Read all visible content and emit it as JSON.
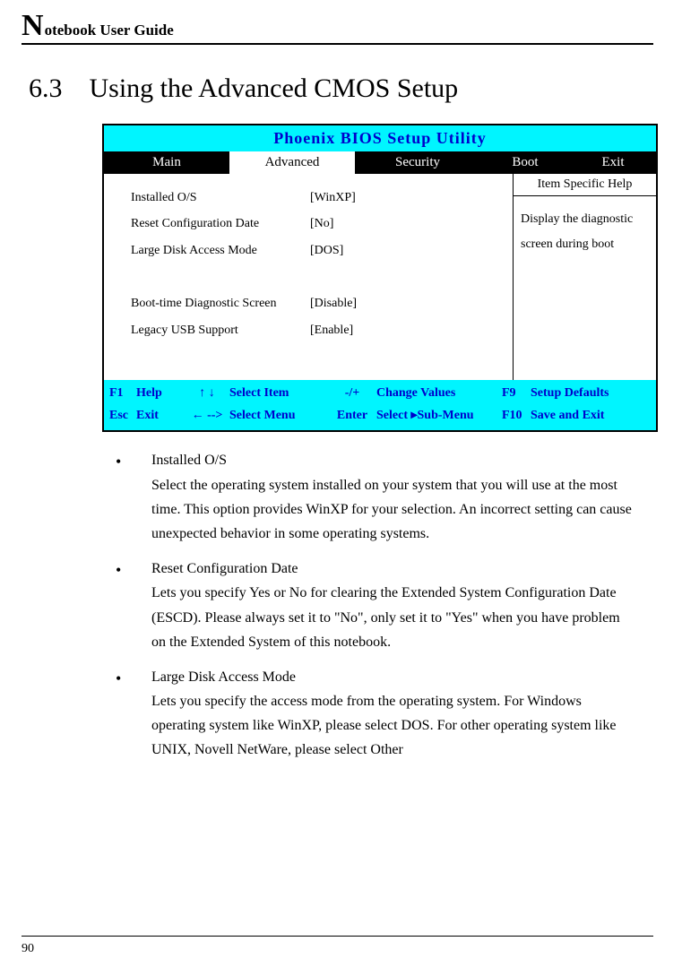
{
  "header": {
    "big_letter": "N",
    "rest": "otebook User Guide"
  },
  "section": {
    "number": "6.3",
    "title": "Using the Advanced CMOS Setup"
  },
  "bios": {
    "title": "Phoenix BIOS Setup Utility",
    "tabs": {
      "main": "Main",
      "advanced": "Advanced",
      "security": "Security",
      "boot": "Boot",
      "exit": "Exit"
    },
    "rows": [
      {
        "label": "Installed O/S",
        "value": "[WinXP]"
      },
      {
        "label": "Reset Configuration Date",
        "value": "[No]"
      },
      {
        "label": "Large Disk Access Mode",
        "value": "[DOS]"
      }
    ],
    "rows2": [
      {
        "label": "Boot-time Diagnostic Screen",
        "value": "[Disable]"
      },
      {
        "label": "Legacy USB Support",
        "value": "[Enable]"
      }
    ],
    "help_header": "Item Specific Help",
    "help_line1": "Display the diagnostic",
    "help_line2": "screen during boot",
    "footer": {
      "r1": {
        "k1": "F1",
        "k2": "Help",
        "k3": "↑  ↓",
        "k4": "Select Item",
        "k5": "-/+",
        "k6": "Change Values",
        "k7": "F9",
        "k8": "Setup Defaults"
      },
      "r2": {
        "k1": "Esc",
        "k2": "Exit",
        "k3": "← -->",
        "k4": "Select Menu",
        "k5": "Enter",
        "k6": "Select  ▸Sub-Menu",
        "k7": "F10",
        "k8": "Save and Exit"
      }
    }
  },
  "bullets": {
    "b1_title": "Installed O/S",
    "b1_body": "Select the operating system installed on your system that you will use at the most time. This option provides WinXP for your selection. An incorrect setting can cause unexpected behavior in some operating systems.",
    "b2_title": "Reset Configuration Date",
    "b2_body": "Lets you specify Yes or No for clearing the Extended System Configuration Date (ESCD). Please always set it to \"No\", only set it to \"Yes\" when you have problem on the Extended System of this notebook.",
    "b3_title": "Large Disk Access Mode",
    "b3_body": "Lets you specify the access mode from the operating system. For Windows operating system like WinXP, please select DOS. For other operating system like UNIX, Novell NetWare, please select Other"
  },
  "page_number": "90"
}
